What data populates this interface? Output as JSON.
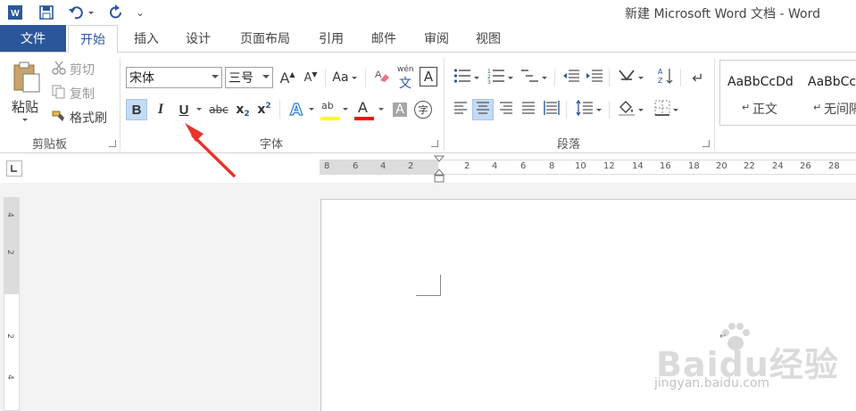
{
  "window": {
    "title": "新建 Microsoft Word 文档 - Word",
    "customize_glyph": "⌄"
  },
  "tabs": [
    {
      "label": "文件"
    },
    {
      "label": "开始"
    },
    {
      "label": "插入"
    },
    {
      "label": "设计"
    },
    {
      "label": "页面布局"
    },
    {
      "label": "引用"
    },
    {
      "label": "邮件"
    },
    {
      "label": "审阅"
    },
    {
      "label": "视图"
    }
  ],
  "clipboard": {
    "paste_label": "粘贴",
    "cut_label": "剪切",
    "copy_label": "复制",
    "format_painter_label": "格式刷",
    "group_label": "剪贴板"
  },
  "font": {
    "font_name": "宋体",
    "font_size": "三号",
    "bold": "B",
    "italic": "I",
    "underline": "U",
    "strike": "abc",
    "subscript": "x",
    "subscript_mark": "2",
    "superscript": "x",
    "superscript_mark": "2",
    "change_case": "Aa",
    "grow": "A",
    "shrink": "A",
    "pinyin_top": "wén",
    "pinyin_bottom": "文",
    "char_border": "A",
    "text_effects": "A",
    "highlight": "ab",
    "font_color": "A",
    "char_shading": "A",
    "enclose": "字",
    "group_label": "字体"
  },
  "paragraph": {
    "group_label": "段落"
  },
  "styles": {
    "items": [
      {
        "sample": "AaBbCcDd",
        "name": "正文",
        "mark": "↵"
      },
      {
        "sample": "AaBbCc",
        "name": "无间隔",
        "mark": "↵"
      }
    ]
  },
  "ruler": {
    "left_ticks": [
      "8",
      "6",
      "4",
      "2"
    ],
    "right_ticks": [
      "2",
      "4",
      "6",
      "8",
      "10",
      "12",
      "14",
      "16",
      "18",
      "20",
      "22",
      "24",
      "26",
      "28"
    ],
    "vertical_ticks": [
      "4",
      "2",
      "2",
      "4"
    ]
  },
  "watermark": {
    "text": "Baidu经验",
    "sub": "jingyan.baidu.com"
  },
  "colors": {
    "accent": "#2b579a",
    "highlight_yellow": "#ffff00",
    "font_red": "#ff0000",
    "annotation_arrow": "#e8342b"
  }
}
